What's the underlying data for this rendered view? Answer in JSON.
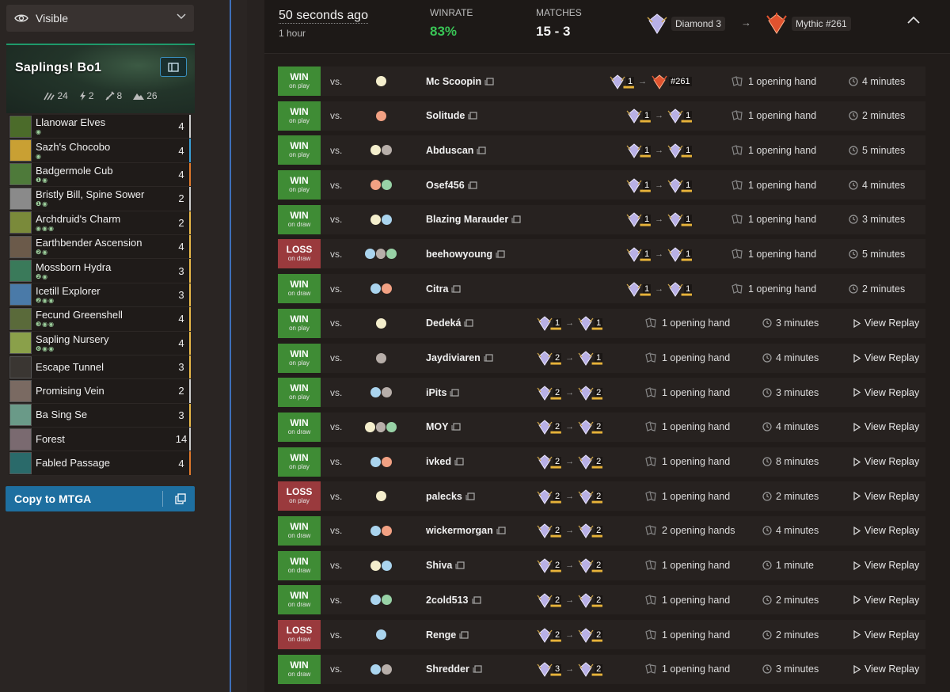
{
  "visibility": {
    "label": "Visible"
  },
  "deck": {
    "name": "Saplings! Bo1",
    "stats": {
      "creatures": "24",
      "spells": "2",
      "other": "8",
      "lands": "26"
    },
    "copy_label": "Copy to MTGA",
    "cards": [
      {
        "name": "Llanowar Elves",
        "cost": "◉",
        "count": "4",
        "art": "#4b6b2a",
        "bar": "#cfcfcf"
      },
      {
        "name": "Sazh's Chocobo",
        "cost": "◉",
        "count": "4",
        "art": "#c9a033",
        "bar": "#3aa0d8"
      },
      {
        "name": "Badgermole Cub",
        "cost": "❶◉",
        "count": "4",
        "art": "#4e7a3a",
        "bar": "#e07a2c"
      },
      {
        "name": "Bristly Bill, Spine Sower",
        "cost": "❶◉",
        "count": "2",
        "art": "#8a8a8a",
        "bar": "#cfcfcf"
      },
      {
        "name": "Archdruid's Charm",
        "cost": "◉◉◉",
        "count": "2",
        "art": "#7a8a3a",
        "bar": "#e9b949"
      },
      {
        "name": "Earthbender Ascension",
        "cost": "❷◉",
        "count": "4",
        "art": "#6b5a4a",
        "bar": "#e9b949"
      },
      {
        "name": "Mossborn Hydra",
        "cost": "❷◉",
        "count": "3",
        "art": "#3a7a5a",
        "bar": "#e9b949"
      },
      {
        "name": "Icetill Explorer",
        "cost": "❷◉◉",
        "count": "3",
        "art": "#4a7aa8",
        "bar": "#e9b949"
      },
      {
        "name": "Fecund Greenshell",
        "cost": "❸◉◉",
        "count": "4",
        "art": "#5a6a3a",
        "bar": "#e9b949"
      },
      {
        "name": "Sapling Nursery",
        "cost": "❻◉◉",
        "count": "4",
        "art": "#8aa04a",
        "bar": "#e9b949"
      },
      {
        "name": "Escape Tunnel",
        "cost": "",
        "count": "3",
        "art": "#3a3632",
        "bar": "#e9b949"
      },
      {
        "name": "Promising Vein",
        "cost": "",
        "count": "2",
        "art": "#7a6a62",
        "bar": "#cfcfcf"
      },
      {
        "name": "Ba Sing Se",
        "cost": "",
        "count": "3",
        "art": "#6a9a88",
        "bar": "#e9b949"
      },
      {
        "name": "Forest",
        "cost": "",
        "count": "14",
        "art": "#7a6a70",
        "bar": "#cfcfcf"
      },
      {
        "name": "Fabled Passage",
        "cost": "",
        "count": "4",
        "art": "#2a6a6a",
        "bar": "#e07a2c"
      }
    ]
  },
  "summary": {
    "when": "50 seconds ago",
    "duration": "1 hour",
    "winrate_label": "WINRATE",
    "winrate": "83%",
    "matches_label": "MATCHES",
    "matches": "15 - 3",
    "rank_from": "Diamond 3",
    "rank_to": "Mythic #261"
  },
  "matches": [
    {
      "result": "WIN",
      "play": "on play",
      "colors": [
        "W"
      ],
      "opponent": "Mc Scoopin",
      "rank_from": "1",
      "rank_to": "#261",
      "rank_to_mythic": true,
      "hands": "1 opening hand",
      "time": "4 minutes",
      "replay": "",
      "tier": "diamond"
    },
    {
      "result": "WIN",
      "play": "on play",
      "colors": [
        "R"
      ],
      "opponent": "Solitude",
      "rank_from": "1",
      "rank_to": "1",
      "hands": "1 opening hand",
      "time": "2 minutes",
      "replay": "",
      "tier": "diamond"
    },
    {
      "result": "WIN",
      "play": "on play",
      "colors": [
        "W",
        "B"
      ],
      "opponent": "Abduscan",
      "rank_from": "1",
      "rank_to": "1",
      "hands": "1 opening hand",
      "time": "5 minutes",
      "replay": "",
      "tier": "diamond"
    },
    {
      "result": "WIN",
      "play": "on play",
      "colors": [
        "R",
        "G"
      ],
      "opponent": "Osef456",
      "rank_from": "1",
      "rank_to": "1",
      "hands": "1 opening hand",
      "time": "4 minutes",
      "replay": "",
      "tier": "diamond"
    },
    {
      "result": "WIN",
      "play": "on draw",
      "colors": [
        "W",
        "U"
      ],
      "opponent": "Blazing Marauder",
      "rank_from": "1",
      "rank_to": "1",
      "hands": "1 opening hand",
      "time": "3 minutes",
      "replay": "",
      "tier": "diamond"
    },
    {
      "result": "LOSS",
      "play": "on draw",
      "colors": [
        "U",
        "B",
        "G"
      ],
      "opponent": "beehowyoung",
      "rank_from": "1",
      "rank_to": "1",
      "hands": "1 opening hand",
      "time": "5 minutes",
      "replay": "",
      "tier": "diamond"
    },
    {
      "result": "WIN",
      "play": "on draw",
      "colors": [
        "U",
        "R"
      ],
      "opponent": "Citra",
      "rank_from": "1",
      "rank_to": "1",
      "hands": "1 opening hand",
      "time": "2 minutes",
      "replay": "",
      "tier": "diamond"
    },
    {
      "result": "WIN",
      "play": "on play",
      "colors": [
        "W"
      ],
      "opponent": "Dedeká",
      "rank_from": "1",
      "rank_to": "1",
      "hands": "1 opening hand",
      "time": "3 minutes",
      "replay": "View Replay",
      "tier": "diamond"
    },
    {
      "result": "WIN",
      "play": "on play",
      "colors": [
        "B"
      ],
      "opponent": "Jaydiviaren",
      "rank_from": "2",
      "rank_to": "1",
      "hands": "1 opening hand",
      "time": "4 minutes",
      "replay": "View Replay",
      "tier": "diamond"
    },
    {
      "result": "WIN",
      "play": "on play",
      "colors": [
        "U",
        "B"
      ],
      "opponent": "iPits",
      "rank_from": "2",
      "rank_to": "2",
      "hands": "1 opening hand",
      "time": "3 minutes",
      "replay": "View Replay",
      "tier": "diamond"
    },
    {
      "result": "WIN",
      "play": "on draw",
      "colors": [
        "W",
        "B",
        "G"
      ],
      "opponent": "MOY",
      "rank_from": "2",
      "rank_to": "2",
      "hands": "1 opening hand",
      "time": "4 minutes",
      "replay": "View Replay",
      "tier": "diamond"
    },
    {
      "result": "WIN",
      "play": "on play",
      "colors": [
        "U",
        "R"
      ],
      "opponent": "ivked",
      "rank_from": "2",
      "rank_to": "2",
      "hands": "1 opening hand",
      "time": "8 minutes",
      "replay": "View Replay",
      "tier": "diamond"
    },
    {
      "result": "LOSS",
      "play": "on play",
      "colors": [
        "W"
      ],
      "opponent": "palecks",
      "rank_from": "2",
      "rank_to": "2",
      "hands": "1 opening hand",
      "time": "2 minutes",
      "replay": "View Replay",
      "tier": "diamond"
    },
    {
      "result": "WIN",
      "play": "on draw",
      "colors": [
        "U",
        "R"
      ],
      "opponent": "wickermorgan",
      "rank_from": "2",
      "rank_to": "2",
      "hands": "2 opening hands",
      "time": "4 minutes",
      "replay": "View Replay",
      "tier": "diamond"
    },
    {
      "result": "WIN",
      "play": "on draw",
      "colors": [
        "W",
        "U"
      ],
      "opponent": "Shiva",
      "rank_from": "2",
      "rank_to": "2",
      "hands": "1 opening hand",
      "time": "1 minute",
      "replay": "View Replay",
      "tier": "diamond"
    },
    {
      "result": "WIN",
      "play": "on draw",
      "colors": [
        "U",
        "G"
      ],
      "opponent": "2cold513",
      "rank_from": "2",
      "rank_to": "2",
      "hands": "1 opening hand",
      "time": "2 minutes",
      "replay": "View Replay",
      "tier": "diamond"
    },
    {
      "result": "LOSS",
      "play": "on draw",
      "colors": [
        "U"
      ],
      "opponent": "Renge",
      "rank_from": "2",
      "rank_to": "2",
      "hands": "1 opening hand",
      "time": "2 minutes",
      "replay": "View Replay",
      "tier": "diamond"
    },
    {
      "result": "WIN",
      "play": "on draw",
      "colors": [
        "U",
        "B"
      ],
      "opponent": "Shredder",
      "rank_from": "3",
      "rank_to": "2",
      "hands": "1 opening hand",
      "time": "3 minutes",
      "replay": "View Replay",
      "tier": "diamond"
    }
  ],
  "labels": {
    "vs": "vs."
  },
  "colors": {
    "win": "#3f8c35",
    "loss": "#9a3a3d",
    "accent": "#1e6fa0",
    "winrate": "#39c556"
  }
}
